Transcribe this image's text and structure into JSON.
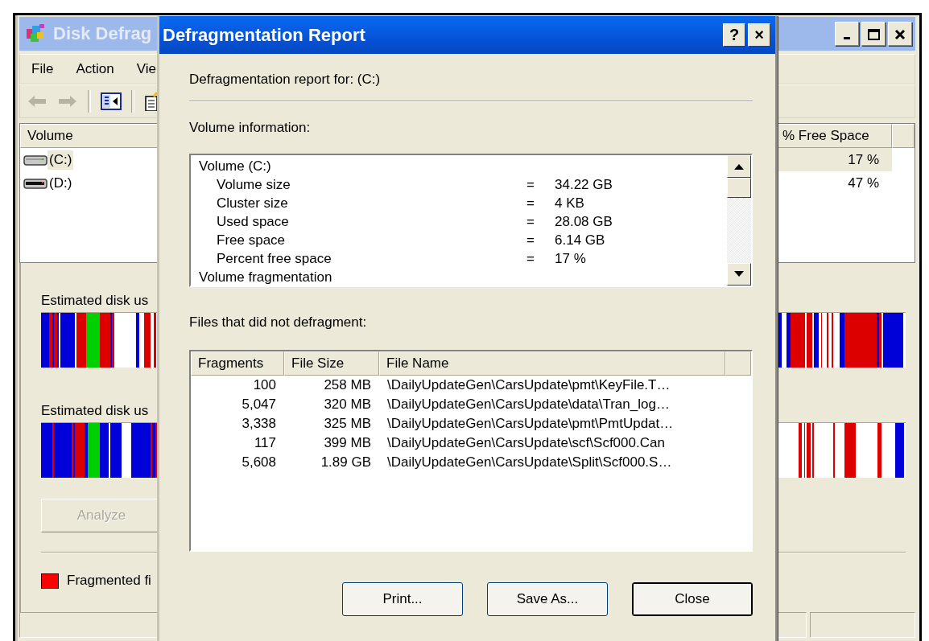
{
  "main_window": {
    "title": "Disk Defrag",
    "menu": [
      "File",
      "Action",
      "Vie"
    ],
    "volumes": {
      "columns": [
        "Volume",
        "% Free Space"
      ],
      "rows": [
        {
          "volume": "(C:)",
          "free_space": "17 %",
          "selected": true
        },
        {
          "volume": "(D:)",
          "free_space": "47 %",
          "selected": false
        }
      ]
    },
    "usage_labels": [
      "Estimated disk us",
      "Estimated disk us"
    ],
    "analyze_button": {
      "label": "Analyze",
      "disabled": true
    },
    "legend": [
      {
        "label": "Fragmented fi",
        "color": "#ff0000"
      }
    ]
  },
  "dialog": {
    "title": "Defragmentation Report",
    "help_button": "?",
    "close_button": "×",
    "report_for": "Defragmentation report for:  (C:)",
    "volume_info_label": "Volume information:",
    "volume_info": [
      {
        "kind": "heading",
        "text": "Volume  (C:)"
      },
      {
        "kind": "field",
        "label": "Volume size",
        "sign": "=",
        "value": "34.22 GB"
      },
      {
        "kind": "field",
        "label": "Cluster size",
        "sign": "=",
        "value": "4 KB"
      },
      {
        "kind": "field",
        "label": "Used space",
        "sign": "=",
        "value": "28.08 GB"
      },
      {
        "kind": "field",
        "label": "Free space",
        "sign": "=",
        "value": "6.14 GB"
      },
      {
        "kind": "field",
        "label": "Percent free space",
        "sign": "=",
        "value": "17 %"
      },
      {
        "kind": "heading",
        "text": "Volume fragmentation"
      }
    ],
    "files_label": "Files that did not defragment:",
    "files": {
      "columns": [
        "Fragments",
        "File Size",
        "File Name"
      ],
      "rows": [
        {
          "fragments": "100",
          "size": "258 MB",
          "name": "\\DailyUpdateGen\\CarsUpdate\\pmt\\KeyFile.T…"
        },
        {
          "fragments": "5,047",
          "size": "320 MB",
          "name": "\\DailyUpdateGen\\CarsUpdate\\data\\Tran_log…"
        },
        {
          "fragments": "3,338",
          "size": "325 MB",
          "name": "\\DailyUpdateGen\\CarsUpdate\\pmt\\PmtUpdat…"
        },
        {
          "fragments": "117",
          "size": "399 MB",
          "name": "\\DailyUpdateGen\\CarsUpdate\\scf\\Scf000.Can"
        },
        {
          "fragments": "5,608",
          "size": "1.89 GB",
          "name": "\\DailyUpdateGen\\CarsUpdate\\Split\\Scf000.S…"
        }
      ]
    },
    "buttons": [
      {
        "label": "Print...",
        "default": false
      },
      {
        "label": "Save As...",
        "default": false
      },
      {
        "label": "Close",
        "default": true
      }
    ]
  }
}
